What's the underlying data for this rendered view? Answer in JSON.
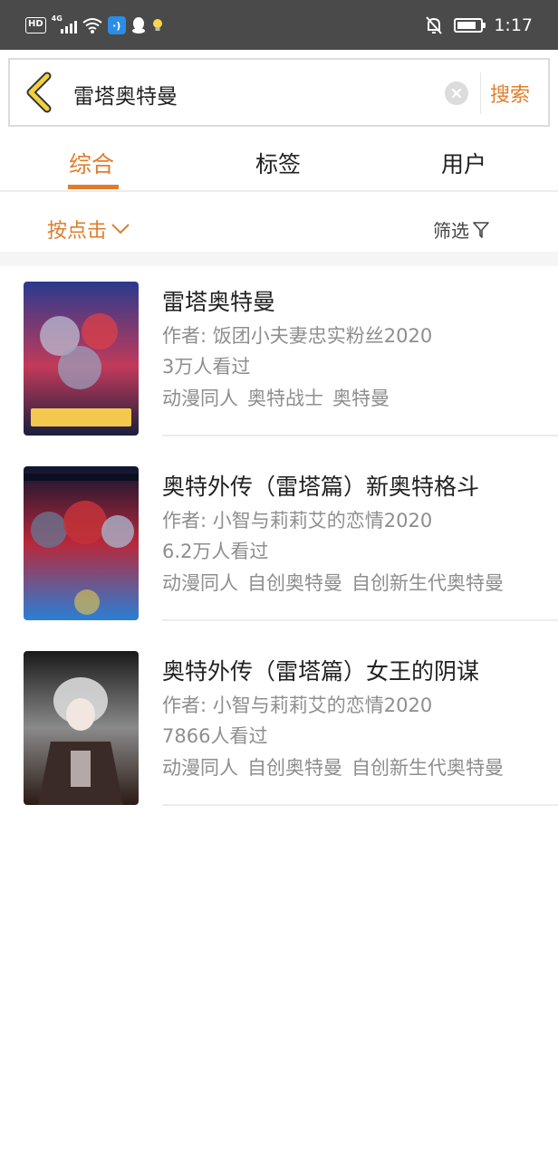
{
  "status_bar": {
    "hd": "HD",
    "network": "4G",
    "app_badge": "·)",
    "time": "1:17"
  },
  "search": {
    "query": "雷塔奥特曼",
    "submit_label": "搜索"
  },
  "tabs": [
    {
      "label": "综合",
      "active": true
    },
    {
      "label": "标签",
      "active": false
    },
    {
      "label": "用户",
      "active": false
    }
  ],
  "filter_bar": {
    "sort_label": "按点击",
    "filter_label": "筛选"
  },
  "results": [
    {
      "title": "雷塔奥特曼",
      "author": "作者: 饭团小夫妻忠实粉丝2020",
      "views": "3万人看过",
      "tags": [
        "动漫同人",
        "奥特战士",
        "奥特曼"
      ],
      "cover": {
        "top": "#2a3a8e",
        "mid": "#c23a5a",
        "bottom": "#1a1f3e",
        "accent": "#f2c94c"
      }
    },
    {
      "title": "奥特外传（雷塔篇）新奥特格斗",
      "author": "作者: 小智与莉莉艾的恋情2020",
      "views": "6.2万人看过",
      "tags": [
        "动漫同人",
        "自创奥特曼",
        "自创新生代奥特曼"
      ],
      "cover": {
        "top": "#0e1530",
        "mid": "#b8283a",
        "bottom": "#2a7fd6",
        "accent": "#e8c94a"
      }
    },
    {
      "title": "奥特外传（雷塔篇）女王的阴谋",
      "author": "作者: 小智与莉莉艾的恋情2020",
      "views": "7866人看过",
      "tags": [
        "动漫同人",
        "自创奥特曼",
        "自创新生代奥特曼"
      ],
      "cover": {
        "top": "#1a1a1a",
        "mid": "#8a8a8a",
        "bottom": "#2b1b14",
        "accent": "#d9d9d9"
      }
    }
  ],
  "colors": {
    "accent": "#e07d2c",
    "status_bar": "#4a4a4a",
    "secondary_text": "#8e8e8e"
  }
}
